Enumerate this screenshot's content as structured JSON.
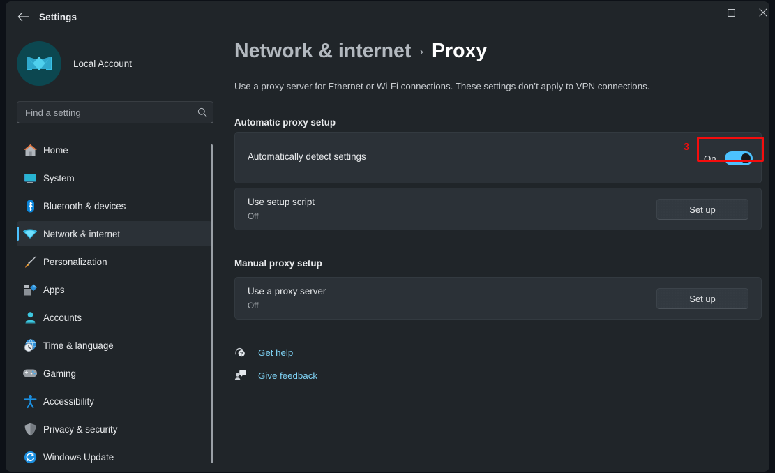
{
  "window": {
    "title": "Settings",
    "back_icon": "back-arrow-icon",
    "minimize_label": "–",
    "maximize_label": "□",
    "close_label": "✕"
  },
  "sidebar": {
    "profile": {
      "name": "Local Account",
      "avatar_icon": "user-avatar-icon",
      "avatar_bg": "#0c4750",
      "avatar_fg": "#4cc2ff"
    },
    "search": {
      "placeholder": "Find a setting",
      "icon": "search-icon"
    },
    "scrollbar": true,
    "items": [
      {
        "label": "Home",
        "icon": "home-icon",
        "selected": false
      },
      {
        "label": "System",
        "icon": "system-icon",
        "selected": false
      },
      {
        "label": "Bluetooth & devices",
        "icon": "bluetooth-icon",
        "selected": false
      },
      {
        "label": "Network & internet",
        "icon": "wifi-icon",
        "selected": true
      },
      {
        "label": "Personalization",
        "icon": "paintbrush-icon",
        "selected": false
      },
      {
        "label": "Apps",
        "icon": "apps-icon",
        "selected": false
      },
      {
        "label": "Accounts",
        "icon": "accounts-icon",
        "selected": false
      },
      {
        "label": "Time & language",
        "icon": "clock-globe-icon",
        "selected": false
      },
      {
        "label": "Gaming",
        "icon": "gamepad-icon",
        "selected": false
      },
      {
        "label": "Accessibility",
        "icon": "accessibility-icon",
        "selected": false
      },
      {
        "label": "Privacy & security",
        "icon": "shield-icon",
        "selected": false
      },
      {
        "label": "Windows Update",
        "icon": "update-icon",
        "selected": false
      }
    ]
  },
  "content": {
    "breadcrumb": {
      "parent": "Network & internet",
      "separator": "›",
      "current": "Proxy"
    },
    "description": "Use a proxy server for Ethernet or Wi-Fi connections. These settings don’t apply to VPN connections.",
    "sections": [
      {
        "title": "Automatic proxy setup"
      },
      {
        "title": "Manual proxy setup"
      }
    ],
    "auto_detect": {
      "label": "Automatically detect settings",
      "toggle_state": "On",
      "toggle_on": true,
      "toggle_color": "#4cc2ff"
    },
    "setup_script": {
      "label": "Use setup script",
      "value": "Off",
      "button_label": "Set up"
    },
    "proxy_server": {
      "label": "Use a proxy server",
      "value": "Off",
      "button_label": "Set up"
    },
    "links": [
      {
        "label": "Get help",
        "icon": "help-icon"
      },
      {
        "label": "Give feedback",
        "icon": "feedback-icon"
      }
    ]
  },
  "annotation": {
    "number": "3",
    "color": "#f50d0d"
  }
}
